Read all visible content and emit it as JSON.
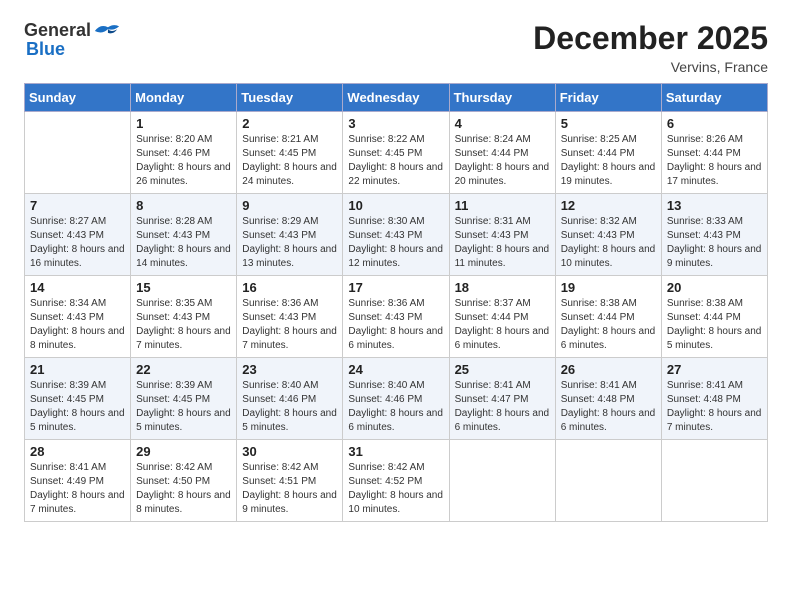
{
  "header": {
    "logo_general": "General",
    "logo_blue": "Blue",
    "month": "December 2025",
    "location": "Vervins, France"
  },
  "days_of_week": [
    "Sunday",
    "Monday",
    "Tuesday",
    "Wednesday",
    "Thursday",
    "Friday",
    "Saturday"
  ],
  "weeks": [
    [
      {
        "day": "",
        "sunrise": "",
        "sunset": "",
        "daylight": ""
      },
      {
        "day": "1",
        "sunrise": "Sunrise: 8:20 AM",
        "sunset": "Sunset: 4:46 PM",
        "daylight": "Daylight: 8 hours and 26 minutes."
      },
      {
        "day": "2",
        "sunrise": "Sunrise: 8:21 AM",
        "sunset": "Sunset: 4:45 PM",
        "daylight": "Daylight: 8 hours and 24 minutes."
      },
      {
        "day": "3",
        "sunrise": "Sunrise: 8:22 AM",
        "sunset": "Sunset: 4:45 PM",
        "daylight": "Daylight: 8 hours and 22 minutes."
      },
      {
        "day": "4",
        "sunrise": "Sunrise: 8:24 AM",
        "sunset": "Sunset: 4:44 PM",
        "daylight": "Daylight: 8 hours and 20 minutes."
      },
      {
        "day": "5",
        "sunrise": "Sunrise: 8:25 AM",
        "sunset": "Sunset: 4:44 PM",
        "daylight": "Daylight: 8 hours and 19 minutes."
      },
      {
        "day": "6",
        "sunrise": "Sunrise: 8:26 AM",
        "sunset": "Sunset: 4:44 PM",
        "daylight": "Daylight: 8 hours and 17 minutes."
      }
    ],
    [
      {
        "day": "7",
        "sunrise": "Sunrise: 8:27 AM",
        "sunset": "Sunset: 4:43 PM",
        "daylight": "Daylight: 8 hours and 16 minutes."
      },
      {
        "day": "8",
        "sunrise": "Sunrise: 8:28 AM",
        "sunset": "Sunset: 4:43 PM",
        "daylight": "Daylight: 8 hours and 14 minutes."
      },
      {
        "day": "9",
        "sunrise": "Sunrise: 8:29 AM",
        "sunset": "Sunset: 4:43 PM",
        "daylight": "Daylight: 8 hours and 13 minutes."
      },
      {
        "day": "10",
        "sunrise": "Sunrise: 8:30 AM",
        "sunset": "Sunset: 4:43 PM",
        "daylight": "Daylight: 8 hours and 12 minutes."
      },
      {
        "day": "11",
        "sunrise": "Sunrise: 8:31 AM",
        "sunset": "Sunset: 4:43 PM",
        "daylight": "Daylight: 8 hours and 11 minutes."
      },
      {
        "day": "12",
        "sunrise": "Sunrise: 8:32 AM",
        "sunset": "Sunset: 4:43 PM",
        "daylight": "Daylight: 8 hours and 10 minutes."
      },
      {
        "day": "13",
        "sunrise": "Sunrise: 8:33 AM",
        "sunset": "Sunset: 4:43 PM",
        "daylight": "Daylight: 8 hours and 9 minutes."
      }
    ],
    [
      {
        "day": "14",
        "sunrise": "Sunrise: 8:34 AM",
        "sunset": "Sunset: 4:43 PM",
        "daylight": "Daylight: 8 hours and 8 minutes."
      },
      {
        "day": "15",
        "sunrise": "Sunrise: 8:35 AM",
        "sunset": "Sunset: 4:43 PM",
        "daylight": "Daylight: 8 hours and 7 minutes."
      },
      {
        "day": "16",
        "sunrise": "Sunrise: 8:36 AM",
        "sunset": "Sunset: 4:43 PM",
        "daylight": "Daylight: 8 hours and 7 minutes."
      },
      {
        "day": "17",
        "sunrise": "Sunrise: 8:36 AM",
        "sunset": "Sunset: 4:43 PM",
        "daylight": "Daylight: 8 hours and 6 minutes."
      },
      {
        "day": "18",
        "sunrise": "Sunrise: 8:37 AM",
        "sunset": "Sunset: 4:44 PM",
        "daylight": "Daylight: 8 hours and 6 minutes."
      },
      {
        "day": "19",
        "sunrise": "Sunrise: 8:38 AM",
        "sunset": "Sunset: 4:44 PM",
        "daylight": "Daylight: 8 hours and 6 minutes."
      },
      {
        "day": "20",
        "sunrise": "Sunrise: 8:38 AM",
        "sunset": "Sunset: 4:44 PM",
        "daylight": "Daylight: 8 hours and 5 minutes."
      }
    ],
    [
      {
        "day": "21",
        "sunrise": "Sunrise: 8:39 AM",
        "sunset": "Sunset: 4:45 PM",
        "daylight": "Daylight: 8 hours and 5 minutes."
      },
      {
        "day": "22",
        "sunrise": "Sunrise: 8:39 AM",
        "sunset": "Sunset: 4:45 PM",
        "daylight": "Daylight: 8 hours and 5 minutes."
      },
      {
        "day": "23",
        "sunrise": "Sunrise: 8:40 AM",
        "sunset": "Sunset: 4:46 PM",
        "daylight": "Daylight: 8 hours and 5 minutes."
      },
      {
        "day": "24",
        "sunrise": "Sunrise: 8:40 AM",
        "sunset": "Sunset: 4:46 PM",
        "daylight": "Daylight: 8 hours and 6 minutes."
      },
      {
        "day": "25",
        "sunrise": "Sunrise: 8:41 AM",
        "sunset": "Sunset: 4:47 PM",
        "daylight": "Daylight: 8 hours and 6 minutes."
      },
      {
        "day": "26",
        "sunrise": "Sunrise: 8:41 AM",
        "sunset": "Sunset: 4:48 PM",
        "daylight": "Daylight: 8 hours and 6 minutes."
      },
      {
        "day": "27",
        "sunrise": "Sunrise: 8:41 AM",
        "sunset": "Sunset: 4:48 PM",
        "daylight": "Daylight: 8 hours and 7 minutes."
      }
    ],
    [
      {
        "day": "28",
        "sunrise": "Sunrise: 8:41 AM",
        "sunset": "Sunset: 4:49 PM",
        "daylight": "Daylight: 8 hours and 7 minutes."
      },
      {
        "day": "29",
        "sunrise": "Sunrise: 8:42 AM",
        "sunset": "Sunset: 4:50 PM",
        "daylight": "Daylight: 8 hours and 8 minutes."
      },
      {
        "day": "30",
        "sunrise": "Sunrise: 8:42 AM",
        "sunset": "Sunset: 4:51 PM",
        "daylight": "Daylight: 8 hours and 9 minutes."
      },
      {
        "day": "31",
        "sunrise": "Sunrise: 8:42 AM",
        "sunset": "Sunset: 4:52 PM",
        "daylight": "Daylight: 8 hours and 10 minutes."
      },
      {
        "day": "",
        "sunrise": "",
        "sunset": "",
        "daylight": ""
      },
      {
        "day": "",
        "sunrise": "",
        "sunset": "",
        "daylight": ""
      },
      {
        "day": "",
        "sunrise": "",
        "sunset": "",
        "daylight": ""
      }
    ]
  ]
}
